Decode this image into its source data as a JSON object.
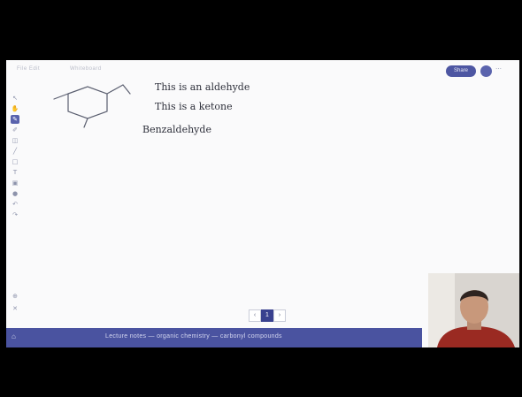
{
  "menubar": {
    "item1": "File Edit",
    "item2": "Whiteboard"
  },
  "header": {
    "share_label": "Share",
    "more_label": "⋯"
  },
  "toolbar": [
    {
      "name": "tool-select-icon",
      "glyph": "↖",
      "active": false
    },
    {
      "name": "tool-hand-icon",
      "glyph": "✋",
      "active": false
    },
    {
      "name": "tool-pen-icon",
      "glyph": "✎",
      "active": true
    },
    {
      "name": "tool-highlighter-icon",
      "glyph": "✐",
      "active": false
    },
    {
      "name": "tool-eraser-icon",
      "glyph": "◫",
      "active": false
    },
    {
      "name": "tool-line-icon",
      "glyph": "╱",
      "active": false
    },
    {
      "name": "tool-shape-icon",
      "glyph": "□",
      "active": false
    },
    {
      "name": "tool-text-icon",
      "glyph": "T",
      "active": false
    },
    {
      "name": "tool-image-icon",
      "glyph": "▣",
      "active": false
    },
    {
      "name": "tool-color-icon",
      "glyph": "●",
      "active": false
    },
    {
      "name": "tool-undo-icon",
      "glyph": "↶",
      "active": false
    },
    {
      "name": "tool-redo-icon",
      "glyph": "↷",
      "active": false
    },
    {
      "name": "tool-zoom-icon",
      "glyph": "⊕",
      "active": false
    },
    {
      "name": "tool-delete-icon",
      "glyph": "✕",
      "active": false
    }
  ],
  "board": {
    "line1": "This is an aldehyde",
    "line2": "This is a ketone",
    "line3": "Benzaldehyde"
  },
  "pager": {
    "prev": "‹",
    "current": "1",
    "next": "›"
  },
  "status": {
    "message": "Lecture notes — organic chemistry — carbonyl compounds"
  },
  "colors": {
    "accent": "#4a53a0",
    "canvas": "#fafafb",
    "ink": "#2d2f3a"
  }
}
